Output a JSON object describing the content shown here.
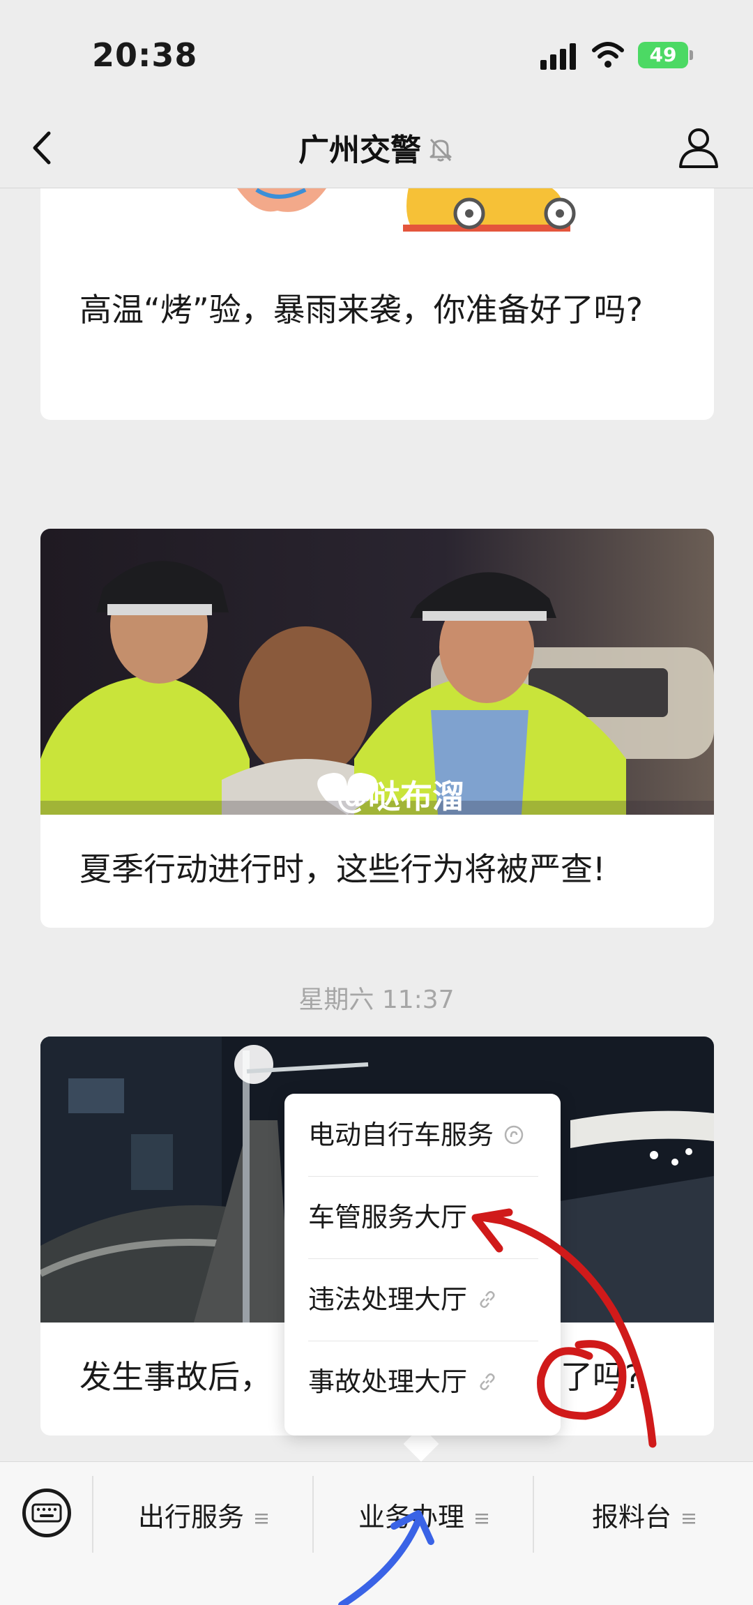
{
  "status_bar": {
    "time": "20:38",
    "battery": "49"
  },
  "nav": {
    "title": "广州交警"
  },
  "feed": [
    {
      "title": "高温“烤”验，暴雨来袭，你准备好了吗?"
    },
    {
      "title": "夏季行动进行时，这些行为将被严查!",
      "watermark": "@哒布溜"
    },
    {
      "timestamp": "星期六 11:37",
      "title_left": "发生事故后，",
      "title_right": "了吗?"
    }
  ],
  "popup_menu": {
    "items": [
      {
        "label": "电动自行车服务"
      },
      {
        "label": "车管服务大厅"
      },
      {
        "label": "违法处理大厅"
      },
      {
        "label": "事故处理大厅"
      }
    ]
  },
  "bottom_menu": {
    "tabs": [
      {
        "label": "出行服务"
      },
      {
        "label": "业务办理"
      },
      {
        "label": "报料台"
      }
    ]
  },
  "colors": {
    "annotation_red": "#d01a1a",
    "annotation_blue": "#3a63e6",
    "battery_green": "#4cd964"
  },
  "icons": [
    "back-chevron-icon",
    "mute-bell-icon",
    "profile-icon",
    "link-icon",
    "keyboard-icon",
    "menu-lines-icon"
  ]
}
